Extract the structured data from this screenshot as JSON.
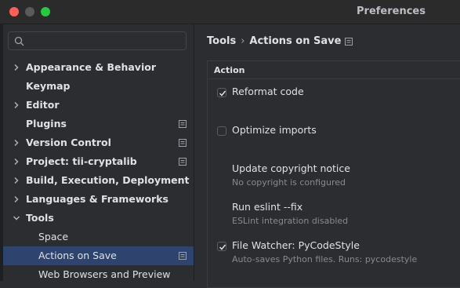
{
  "window": {
    "title": "Preferences"
  },
  "search": {
    "placeholder": ""
  },
  "sidebar": {
    "items": [
      {
        "label": "Appearance & Behavior",
        "expandable": true,
        "expanded": false,
        "project_icon": false,
        "selected": false,
        "level": 0
      },
      {
        "label": "Keymap",
        "expandable": false,
        "project_icon": false,
        "selected": false,
        "level": 0
      },
      {
        "label": "Editor",
        "expandable": true,
        "expanded": false,
        "project_icon": false,
        "selected": false,
        "level": 0
      },
      {
        "label": "Plugins",
        "expandable": false,
        "project_icon": true,
        "selected": false,
        "level": 0
      },
      {
        "label": "Version Control",
        "expandable": true,
        "expanded": false,
        "project_icon": true,
        "selected": false,
        "level": 0
      },
      {
        "label": "Project: tii-cryptalib",
        "expandable": true,
        "expanded": false,
        "project_icon": true,
        "selected": false,
        "level": 0
      },
      {
        "label": "Build, Execution, Deployment",
        "expandable": true,
        "expanded": false,
        "project_icon": false,
        "selected": false,
        "level": 0
      },
      {
        "label": "Languages & Frameworks",
        "expandable": true,
        "expanded": false,
        "project_icon": false,
        "selected": false,
        "level": 0
      },
      {
        "label": "Tools",
        "expandable": true,
        "expanded": true,
        "project_icon": false,
        "selected": false,
        "level": 0
      },
      {
        "label": "Space",
        "expandable": false,
        "project_icon": false,
        "selected": false,
        "level": 1
      },
      {
        "label": "Actions on Save",
        "expandable": false,
        "project_icon": true,
        "selected": true,
        "level": 1
      },
      {
        "label": "Web Browsers and Preview",
        "expandable": false,
        "project_icon": false,
        "selected": false,
        "level": 1
      }
    ]
  },
  "breadcrumb": {
    "parent": "Tools",
    "separator": "›",
    "current": "Actions on Save"
  },
  "table": {
    "header": "Action",
    "rows": [
      {
        "title": "Reformat code",
        "desc": "",
        "checkbox": true,
        "checked": true
      },
      {
        "title": "Optimize imports",
        "desc": "",
        "checkbox": true,
        "checked": false
      },
      {
        "title": "Update copyright notice",
        "desc": "No copyright is configured",
        "checkbox": false,
        "checked": false
      },
      {
        "title": "Run eslint --fix",
        "desc": "ESLint integration disabled",
        "checkbox": false,
        "checked": false
      },
      {
        "title": "File Watcher: PyCodeStyle",
        "desc": "Auto-saves Python files. Runs: pycodestyle",
        "checkbox": true,
        "checked": true
      }
    ]
  },
  "colors": {
    "selection": "#2e436e",
    "background": "#2b2d30",
    "close": "#ff5f57",
    "maximize": "#28c840"
  }
}
